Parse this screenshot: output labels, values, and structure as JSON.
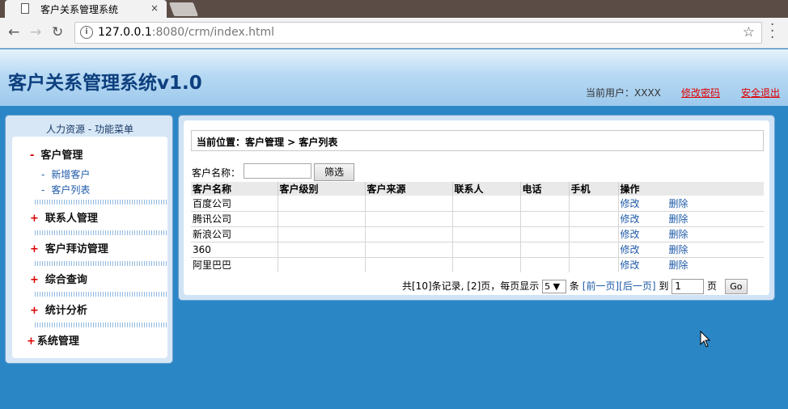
{
  "browser": {
    "tab_title": "客户关系管理系统",
    "tab_close": "×",
    "url_host": "127.0.0.1",
    "url_rest": ":8080/crm/index.html"
  },
  "header": {
    "app_title": "客户关系管理系统v1.0",
    "current_user": "当前用户：XXXX",
    "change_password": "修改密码",
    "logout": "安全退出"
  },
  "sidebar": {
    "title": "人力资源  - 功能菜单",
    "groups": [
      {
        "sign": "-",
        "label": "客户管理"
      },
      {
        "sign": "+",
        "label": "联系人管理"
      },
      {
        "sign": "+",
        "label": "客户拜访管理"
      },
      {
        "sign": "+",
        "label": "综合查询"
      },
      {
        "sign": "+",
        "label": "统计分析"
      },
      {
        "sign": "+",
        "label": "系统管理"
      }
    ],
    "subitems": [
      {
        "dash": "-",
        "label": "新增客户"
      },
      {
        "dash": "-",
        "label": "客户列表"
      }
    ]
  },
  "main": {
    "breadcrumb": "当前位置：客户管理 > 客户列表",
    "filter_label": "客户名称：",
    "filter_value": "",
    "filter_button": "筛选",
    "columns": [
      "客户名称",
      "客户级别",
      "客户来源",
      "联系人",
      "电话",
      "手机",
      "操作"
    ],
    "rows": [
      {
        "name": "百度公司",
        "edit": "修改",
        "delete": "删除"
      },
      {
        "name": "腾讯公司",
        "edit": "修改",
        "delete": "删除"
      },
      {
        "name": "新浪公司",
        "edit": "修改",
        "delete": "删除"
      },
      {
        "name": "360",
        "edit": "修改",
        "delete": "删除"
      },
      {
        "name": "阿里巴巴",
        "edit": "修改",
        "delete": "删除"
      }
    ],
    "pager": {
      "summary": "共[10]条记录, [2]页，每页显示",
      "page_size": "5",
      "unit": "条",
      "prev": "[前一页]",
      "next": "[后一页]",
      "to": "到",
      "page_value": "1",
      "page_word": "页",
      "go": "Go"
    }
  }
}
